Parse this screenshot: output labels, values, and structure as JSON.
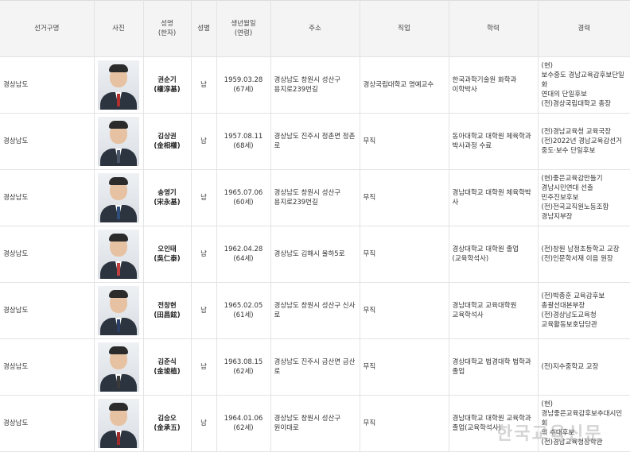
{
  "headers": {
    "district": "선거구명",
    "photo": "사진",
    "name": "성명\n(한자)",
    "gender": "성별",
    "birth": "생년월일\n(연령)",
    "address": "주소",
    "job": "직업",
    "education": "학력",
    "career": "경력"
  },
  "rows": [
    {
      "district": "경상남도",
      "name": "권순기",
      "hanja": "(權淳基)",
      "gender": "남",
      "birth": "1959.03.28",
      "age": "(67세)",
      "address": "경상남도 창원시 성산구\n용지로239번길",
      "job": "경상국립대학교 명예교수",
      "education": "한국과학기술원 화학과\n이학박사",
      "career": "(현)\n보수중도 경남교육감후보단일화\n연대의 단일후보\n(전)경상국립대학교 총장",
      "tie_color": "#b0302d"
    },
    {
      "district": "경상남도",
      "name": "김상권",
      "hanja": "(金相權)",
      "gender": "남",
      "birth": "1957.08.11",
      "age": "(68세)",
      "address": "경상남도 진주시 정촌면 정촌로",
      "job": "무직",
      "education": "동아대학교 대학원 체육학과\n박사과정 수료",
      "career": "(전)경남교육청 교육국장\n(전)2022년 경남교육감선거\n중도·보수 단일후보",
      "tie_color": "#4a5568"
    },
    {
      "district": "경상남도",
      "name": "송영기",
      "hanja": "(宋永基)",
      "gender": "남",
      "birth": "1965.07.06",
      "age": "(60세)",
      "address": "경상남도 창원시 성산구\n용지로239번길",
      "job": "무직",
      "education": "경남대학교 대학원 체육학박사",
      "career": "(현)좋은교육감만들기\n경남시민연대 선출\n민주진보후보\n(전)전국교직원노동조합\n경남지부장",
      "tie_color": "#2f4f7a"
    },
    {
      "district": "경상남도",
      "name": "오인태",
      "hanja": "(吳仁泰)",
      "gender": "남",
      "birth": "1962.04.28",
      "age": "(64세)",
      "address": "경상남도 김해시 율하5로",
      "job": "무직",
      "education": "경상대학교 대학원 졸업\n(교육학석사)",
      "career": "(전)창원 남정초등학교 교장\n(전)인문학서재 이음 원장",
      "tie_color": "#c04040"
    },
    {
      "district": "경상남도",
      "name": "전창현",
      "hanja": "(田昌鉉)",
      "gender": "남",
      "birth": "1965.02.05",
      "age": "(61세)",
      "address": "경상남도 창원시 성산구 신사로",
      "job": "무직",
      "education": "경남대학교 교육대학원\n교육학석사",
      "career": "(전)박종훈 교육감후보\n총괄선대본부장\n(전)경상남도교육청\n교육활동보호담당관",
      "tie_color": "#2d3e66"
    },
    {
      "district": "경상남도",
      "name": "김준식",
      "hanja": "(金埈植)",
      "gender": "남",
      "birth": "1963.08.15",
      "age": "(62세)",
      "address": "경상남도 진주시 금산면 금산로",
      "job": "무직",
      "education": "경상대학교 법경대학 법학과\n졸업",
      "career": "(전)지수중학교 교장",
      "tie_color": "#3a3a3a"
    },
    {
      "district": "경상남도",
      "name": "김승오",
      "hanja": "(金承五)",
      "gender": "남",
      "birth": "1964.01.06",
      "age": "(62세)",
      "address": "경상남도 창원시 성산구\n원이대로",
      "job": "무직",
      "education": "경남대학교 대학원 교육학과\n졸업(교육학석사)",
      "career": "(현)\n경남좋은교육감후보추대시민회\n의 추대후보\n(전)경남교육청장학관",
      "tie_color": "#9e2b2b"
    }
  ],
  "watermark": "한국교육신문"
}
